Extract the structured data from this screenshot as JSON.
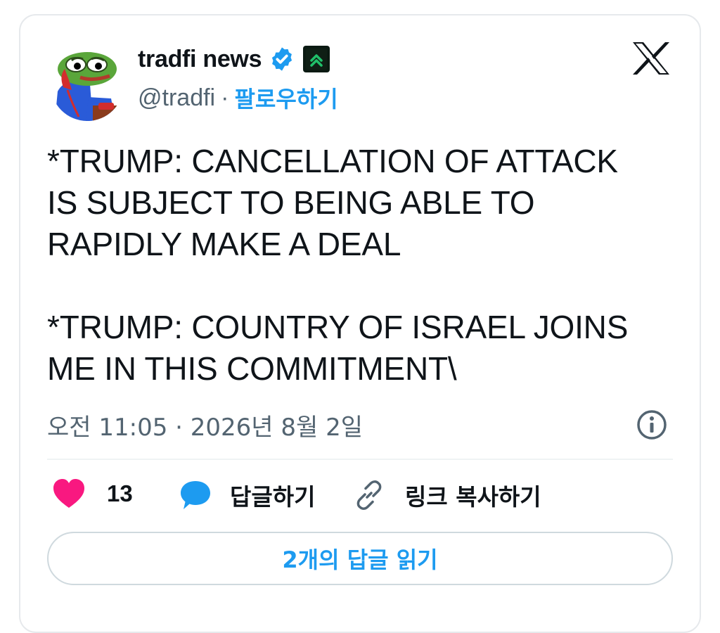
{
  "author": {
    "name": "tradfi news",
    "handle": "@tradfi",
    "follow_label": "팔로우하기",
    "separator": "·"
  },
  "icons": {
    "avatar": "pepe-phone-avatar",
    "verified": "verified-badge-icon",
    "badge": "green-chevrons-badge-icon",
    "platform": "x-logo-icon",
    "info": "info-icon",
    "like": "heart-icon",
    "reply": "speech-bubble-icon",
    "copy": "link-icon"
  },
  "tweet": {
    "text": "*TRUMP: CANCELLATION OF ATTACK\nIS SUBJECT TO BEING ABLE TO\nRAPIDLY MAKE A DEAL\n\n*TRUMP: COUNTRY OF ISRAEL JOINS\nME IN THIS COMMITMENT\\",
    "timestamp": "오전 11:05 · 2026년 8월 2일"
  },
  "actions": {
    "like_count": "13",
    "reply_label": "답글하기",
    "copy_link_label": "링크 복사하기"
  },
  "read_replies_label": "2개의 답글 읽기",
  "colors": {
    "accent": "#1d9bf0",
    "like": "#f91880",
    "text": "#0f1419",
    "secondary": "#536471"
  }
}
